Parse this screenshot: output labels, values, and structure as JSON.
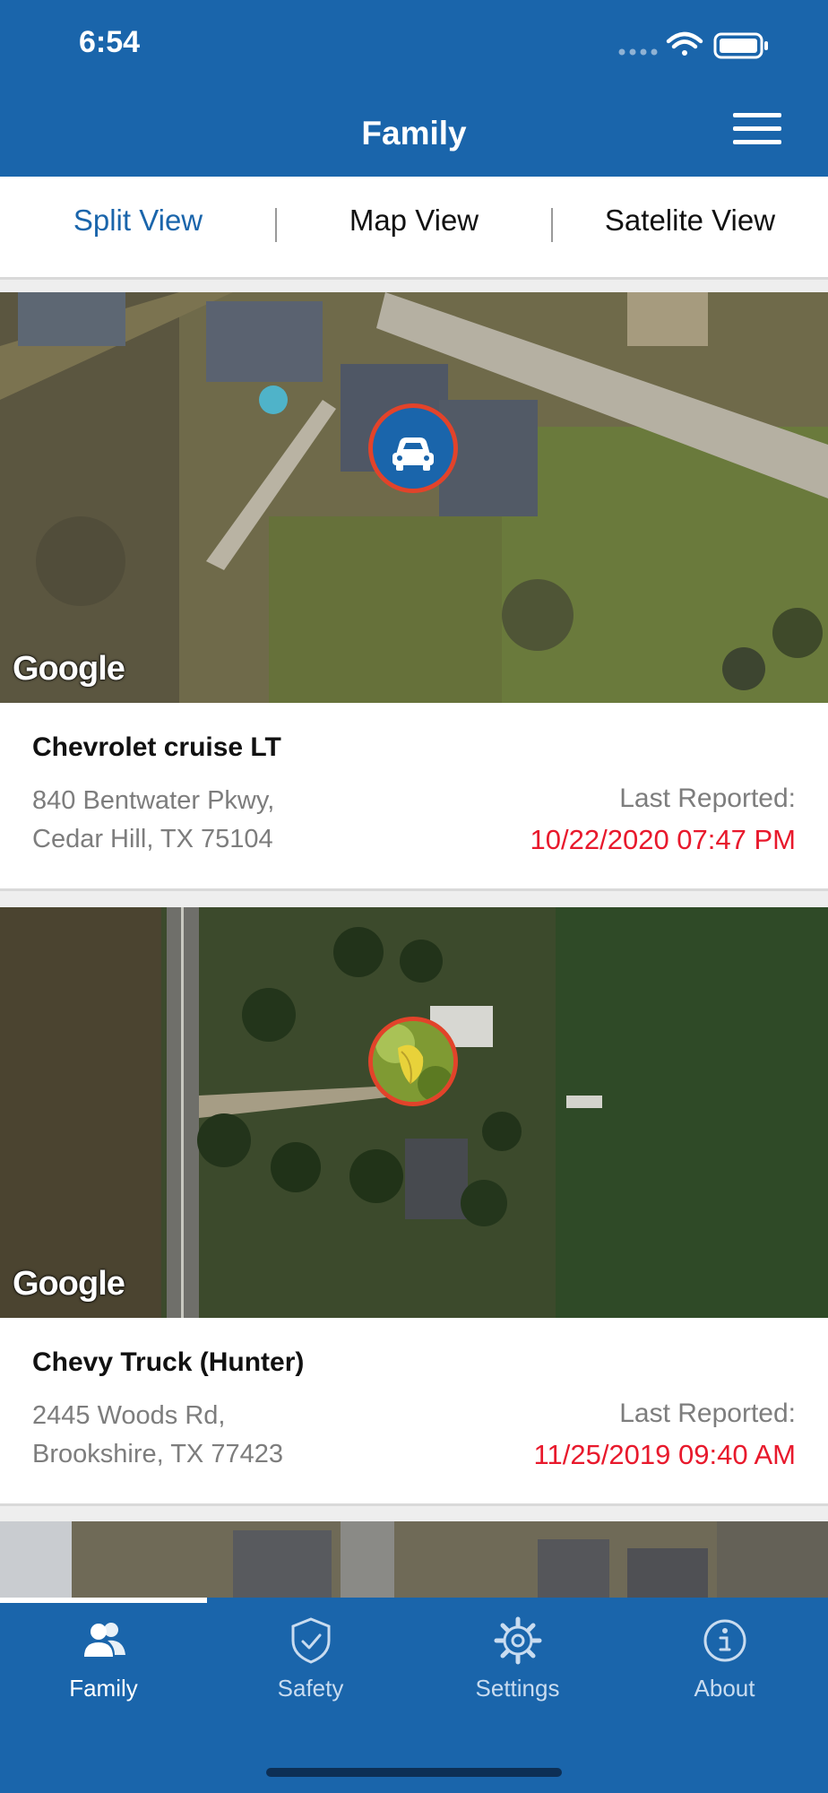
{
  "status_bar": {
    "time": "6:54"
  },
  "header": {
    "title": "Family"
  },
  "view_tabs": [
    {
      "label": "Split View",
      "active": true
    },
    {
      "label": "Map View",
      "active": false
    },
    {
      "label": "Satelite View",
      "active": false
    }
  ],
  "vehicles": [
    {
      "name": "Chevrolet cruise LT",
      "address_line1": "840 Bentwater Pkwy,",
      "address_line2": "Cedar Hill, TX 75104",
      "last_reported_label": "Last Reported:",
      "last_reported_time": "10/22/2020 07:47 PM",
      "map_attribution": "Google",
      "pin_icon": "car-icon"
    },
    {
      "name": "Chevy Truck (Hunter)",
      "address_line1": "2445 Woods Rd,",
      "address_line2": "Brookshire, TX 77423",
      "last_reported_label": "Last Reported:",
      "last_reported_time": "11/25/2019 09:40 AM",
      "map_attribution": "Google",
      "pin_icon": "leaf-photo-avatar"
    }
  ],
  "tab_bar": [
    {
      "label": "Family",
      "icon": "family-icon",
      "active": true
    },
    {
      "label": "Safety",
      "icon": "shield-icon",
      "active": false
    },
    {
      "label": "Settings",
      "icon": "gear-icon",
      "active": false
    },
    {
      "label": "About",
      "icon": "info-icon",
      "active": false
    }
  ],
  "colors": {
    "brand_blue": "#1a65ab",
    "timestamp_red": "#e8192c",
    "pin_border": "#e2432a",
    "secondary_text": "#7d7d7d"
  }
}
